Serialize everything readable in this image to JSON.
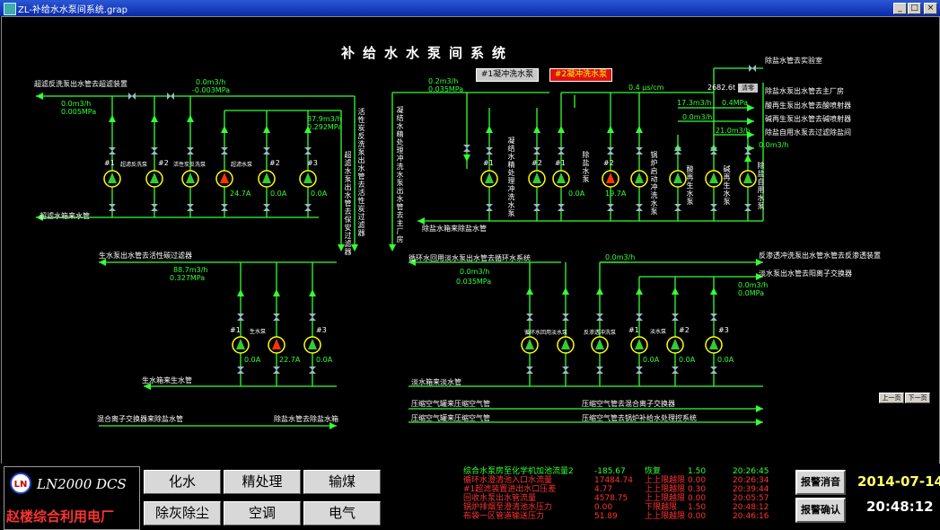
{
  "window": {
    "title": "ZL-补给水水泵间系统.grap",
    "min": "_",
    "max": "□",
    "close": "×"
  },
  "page_title": "补给水水泵间系统",
  "buttons": {
    "flush1": "#1凝冲洗水泵",
    "flush2": "#2凝冲洗水泵",
    "prev_page": "上一页",
    "next_page": "下一页",
    "clear": "清零"
  },
  "labels": {
    "uf_backwash": "超滤反洗泵出水管去超滤装置",
    "uf_tank": "超滤水箱来水管",
    "uf_out_vertical": "超滤水泵出水管去保安过滤器",
    "carbon_vertical": "活性炭反洗泵出水管去活性炭过滤器",
    "condensate_vertical": "凝结水精处理冲洗水泵出水管去主厂房",
    "raw_to_carbon": "生水泵出水管去活性碳过滤器",
    "raw_tank": "生水箱来生水管",
    "mixed_bed": "混合离子交换器来除盐水管",
    "demin_to_tank": "除盐水管去除盐水箱",
    "circ_water": "循环水回用淡水泵出水管去循环水系统",
    "fresh_tank": "淡水箱来淡水管",
    "air1": "压缩空气罐来压缩空气管",
    "air2": "压缩空气管去混合离子交换器",
    "air3": "压缩空气罐来压缩空气管",
    "air4": "压缩空气管去锅炉补给水处理控系统",
    "demin_tank_in": "除盐水箱来除盐水管",
    "lab": "除盐水管去实验室",
    "main_plant": "除盐水泵出水管去主厂房",
    "acid_regen": "酸再生泵出水管去酸喷射器",
    "alkali_regen": "碱再生泵出水管去碱喷射器",
    "self_use": "除盐自用水泵去过滤除盐间",
    "ro_backwash": "反渗透冲洗泵出水管水管去反渗透装置",
    "fresh_to_ion": "淡水泵出水管去阳离子交换器"
  },
  "readings": {
    "uf_left_flow": "0.0m3/h",
    "uf_left_press": "0.005MPa",
    "uf_mid_flow": "0.0m3/h",
    "uf_mid_press": "-0.003MPa",
    "uf_right_flow": "87.9m3/h",
    "uf_right_press": "0.292MPa",
    "cond_flow": "0.2m3/h",
    "cond_press": "0.035MPa",
    "conductivity": "0.4 μs/cm",
    "total_flow": "2682.6t",
    "main_flow": "17.3m3/h",
    "main_press": "0.4MPa",
    "acid_flow": "0.0m3/h",
    "alkali_flow": "21.0m3/h",
    "self_flow": "0.0m3/h",
    "raw_flow": "88.7m3/h",
    "raw_press": "0.327MPa",
    "circ_flow": "0.0m3/h",
    "circ_press": "0.035MPa",
    "ro_flow": "0.0m3/h",
    "fresh_flow": "0.0m3/h",
    "fresh_press": "0.0MPa"
  },
  "pumps": {
    "uf_backwash": {
      "id": "#1",
      "name": "超滤反洗泵"
    },
    "carbon_backwash": {
      "id": "#2",
      "name": "活性炭反洗泵"
    },
    "uf1": {
      "id": "超滤水泵",
      "amp": "24.7A"
    },
    "uf2": {
      "id": "#2",
      "amp": "0.0A"
    },
    "uf3": {
      "id": "#3",
      "amp": "0.0A"
    },
    "cond1": {
      "id": "#1"
    },
    "cond2": {
      "id": "#2"
    },
    "demin1": {
      "id": "#1",
      "amp": "0.0A"
    },
    "demin2": {
      "id": "#2",
      "amp": "19.7A"
    },
    "demin_name": "除盐水泵",
    "boiler_flush": "锅炉启动冲洗水泵",
    "acid_regen": "酸再生水泵",
    "alkali_regen": "碱再生水泵",
    "self_use": "除盐自用水泵",
    "cond_name": "凝结水精处理冲洗水泵",
    "raw1": {
      "id": "#1",
      "amp": "0.0A"
    },
    "raw_name": "生水泵",
    "raw2": {
      "amp": "22.7A"
    },
    "raw3": {
      "id": "#3",
      "amp": "0.0A"
    },
    "circ": "循环水回用淡水泵",
    "ro_flush": "反渗透冲洗泵",
    "fresh1": {
      "id": "#1",
      "amp": "0.0A"
    },
    "fresh_name": "淡水泵",
    "fresh2": {
      "id": "#2",
      "amp": "0.0A"
    },
    "fresh3": {
      "id": "#3",
      "amp": "0.0A"
    }
  },
  "bottom": {
    "brand": "LN2000 DCS",
    "company": "赵楼综合利用电厂",
    "menu": [
      "化水",
      "精处理",
      "输煤",
      "除灰除尘",
      "空调",
      "电气"
    ],
    "alarm_silence": "报警消音",
    "alarm_confirm": "报警确认",
    "date": "2014-07-14",
    "time": "20:48:12",
    "alarms": [
      {
        "name": "综合水泵房至化学机加池流量2",
        "value": "-185.67",
        "state": "恢复",
        "limit": "1.50",
        "time": "20:26:45",
        "color": "#33ff33"
      },
      {
        "name": "循环水澄清池入口水流量",
        "value": "17484.74",
        "state": "上上限越限",
        "limit": "0.00",
        "time": "20:26:34",
        "color": "#ff3333"
      },
      {
        "name": "#1超滤装置进出水口压差",
        "value": "4.77",
        "state": "上上限越限",
        "limit": "0.30",
        "time": "20:39:44",
        "color": "#ff3333"
      },
      {
        "name": "回收水泵出水管流量",
        "value": "4578.75",
        "state": "上上限越限",
        "limit": "0.00",
        "time": "20:05:57",
        "color": "#ff3333"
      },
      {
        "name": "锅炉排烟至澄清池水压力",
        "value": "0.00",
        "state": "下限越限",
        "limit": "1.50",
        "time": "20:48:12",
        "color": "#ff3333"
      },
      {
        "name": "布袋一区管道输送压力",
        "value": "51.89",
        "state": "上上限越限",
        "limit": "0.00",
        "time": "20:46:16",
        "color": "#ff3333"
      }
    ]
  },
  "colors": {
    "pipe": "#33ff33",
    "pump_running": "#ff3300",
    "pump_stopped": "#33cc33",
    "pump_ring": "#ffff00",
    "valve": "#9fb8c8"
  }
}
